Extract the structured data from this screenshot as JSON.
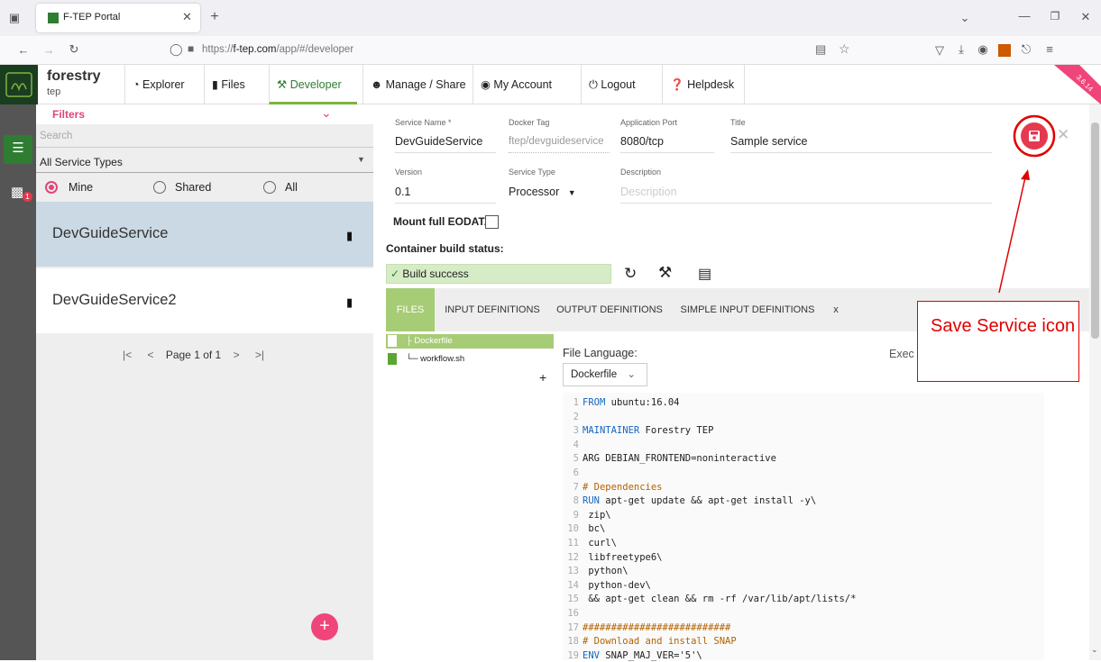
{
  "browser": {
    "tab_title": "F-TEP Portal",
    "url_prefix": "https://",
    "url_domain": "f-tep.com",
    "url_path": "/app/#/developer"
  },
  "nav": {
    "logo_title": "forestry",
    "logo_sub": "tep",
    "items": [
      "Explorer",
      "Files",
      "Developer",
      "Manage / Share",
      "My Account",
      "Logout",
      "Helpdesk"
    ],
    "version_ribbon": "3.6.14"
  },
  "sidebar": {
    "badge": "1"
  },
  "filters": {
    "title": "Filters",
    "search_placeholder": "Search",
    "type_select": "All Service Types",
    "radios": [
      "Mine",
      "Shared",
      "All"
    ],
    "services": [
      "DevGuideService",
      "DevGuideService2"
    ],
    "pagination": "Page 1 of 1"
  },
  "form": {
    "labels": {
      "service_name": "Service Name *",
      "docker_tag": "Docker Tag",
      "app_port": "Application Port",
      "title": "Title",
      "version": "Version",
      "service_type": "Service Type",
      "description": "Description"
    },
    "values": {
      "service_name": "DevGuideService",
      "docker_tag": "ftep/devguideservice",
      "app_port": "8080/tcp",
      "title": "Sample service",
      "version": "0.1",
      "service_type": "Processor",
      "description_placeholder": "Description"
    },
    "mount_label": "Mount full EODATA",
    "build_status_label": "Container build status:",
    "build_status": "Build success"
  },
  "tabs": [
    "FILES",
    "INPUT DEFINITIONS",
    "OUTPUT DEFINITIONS",
    "SIMPLE INPUT DEFINITIONS",
    "x"
  ],
  "files": [
    "Dockerfile",
    "workflow.sh"
  ],
  "file_language_label": "File Language:",
  "file_language": "Dockerfile",
  "exec_label": "Exec",
  "code_lines": [
    "FROM ubuntu:16.04",
    "",
    "MAINTAINER Forestry TEP",
    "",
    "ARG DEBIAN_FRONTEND=noninteractive",
    "",
    "# Dependencies",
    "RUN apt-get update && apt-get install -y\\",
    " zip\\",
    " bc\\",
    " curl\\",
    " libfreetype6\\",
    " python\\",
    " python-dev\\",
    " && apt-get clean && rm -rf /var/lib/apt/lists/*",
    "",
    "##########################",
    "# Download and install SNAP",
    "ENV SNAP_MAJ_VER='5'\\"
  ],
  "annotation": {
    "text": "Save Service icon",
    "color": "#e00000"
  },
  "colors": {
    "accent_green": "#7cb342",
    "pink": "#f0457a",
    "save_red": "#e53950"
  }
}
